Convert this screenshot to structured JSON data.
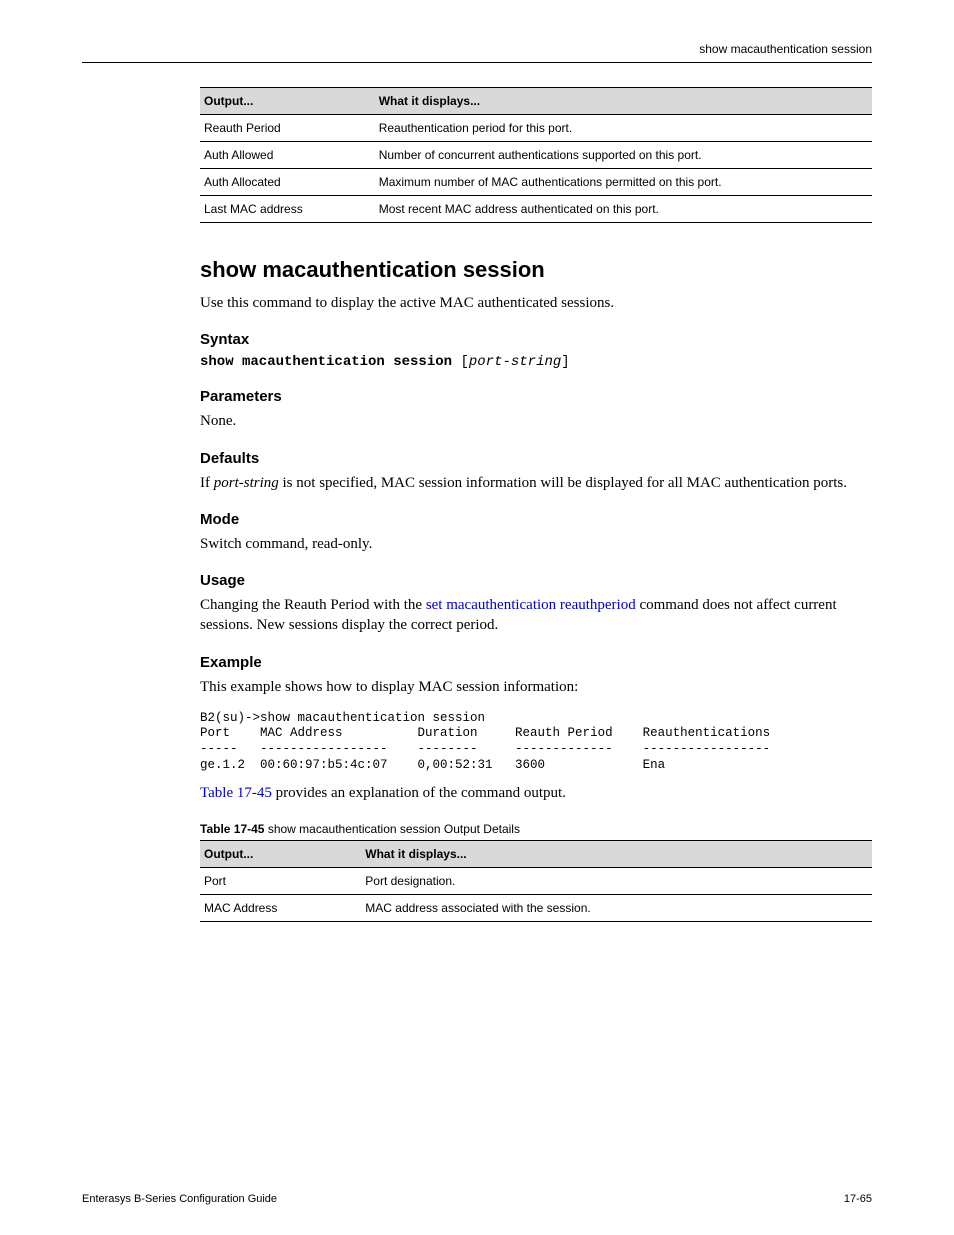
{
  "running_head": "show macauthentication session",
  "def_table": {
    "col_key": "Output...",
    "col_val": "What it displays...",
    "rows": [
      {
        "key": "Reauth Period",
        "val": "Reauthentication period for this port."
      },
      {
        "key": "Auth Allowed",
        "val": "Number of concurrent authentications supported on this port."
      },
      {
        "key": "Auth Allocated",
        "val": "Maximum number of MAC authentications permitted on this port."
      },
      {
        "key": "Last MAC address",
        "val": "Most recent MAC address authenticated on this port."
      }
    ]
  },
  "cmd_title": "show macauthentication session",
  "intro": "Use this command to display the active MAC authenticated sessions.",
  "syntax_head": "Syntax",
  "syntax_kw": "show macauthentication session",
  "syntax_arg": "port-string",
  "params_head": "Parameters",
  "params_body": "None.",
  "defaults_head": "Defaults",
  "defaults_pre": "If ",
  "defaults_arg": "port-string",
  "defaults_post": " is not specified, MAC session information will be displayed for all MAC authentication ports.",
  "mode_head": "Mode",
  "mode_body": "Switch command, read-only.",
  "usage_head": "Usage",
  "usage_pre": "Changing the Reauth Period with the ",
  "usage_link": "set macauthentication reauthperiod",
  "usage_post": " command does not affect current sessions. New sessions display the correct period.",
  "example_head": "Example",
  "example_intro": "This example shows how to display MAC session information:",
  "example_block": "B2(su)->show macauthentication session\nPort    MAC Address          Duration     Reauth Period    Reauthentications\n-----   -----------------    --------     -------------    -----------------\nge.1.2  00:60:97:b5:4c:07    0,00:52:31   3600             Ena",
  "outref_pre_link": "Table 17-45",
  "outref_post": " provides an explanation of the command output.",
  "out_table": {
    "caption_bold": "Table 17-45",
    "caption_rest": "show macauthentication session Output Details",
    "col1": "Output...",
    "col2": "What it displays...",
    "rows": [
      {
        "key": "Port",
        "val": "Port designation."
      },
      {
        "key": "MAC Address",
        "val": "MAC address associated with the session."
      }
    ]
  },
  "footer_left": "Enterasys B-Series Configuration Guide",
  "footer_right": "17-65"
}
